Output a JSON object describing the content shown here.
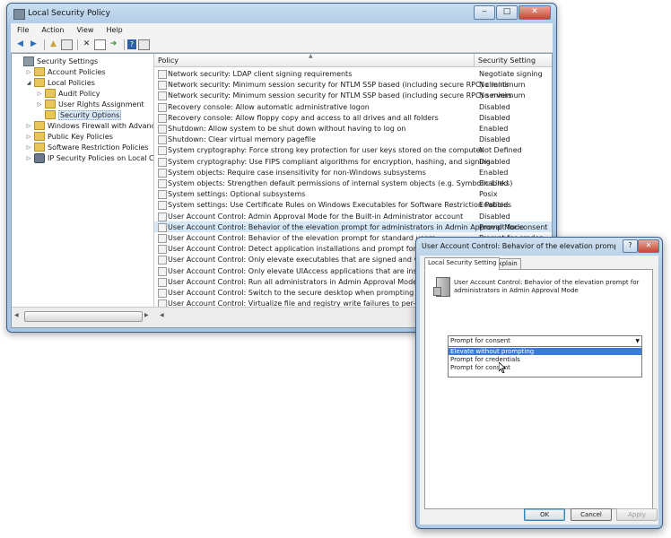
{
  "window": {
    "title": "Local Security Policy",
    "caption_buttons": [
      "‒",
      "□",
      "✕"
    ]
  },
  "menu": [
    "File",
    "Action",
    "View",
    "Help"
  ],
  "tree": [
    {
      "label": "Security Settings",
      "level": 0,
      "toggle": "",
      "icon": "shield"
    },
    {
      "label": "Account Policies",
      "level": 1,
      "toggle": "▷",
      "icon": "folder"
    },
    {
      "label": "Local Policies",
      "level": 1,
      "toggle": "◢",
      "icon": "folder"
    },
    {
      "label": "Audit Policy",
      "level": 2,
      "toggle": "▷",
      "icon": "folder"
    },
    {
      "label": "User Rights Assignment",
      "level": 2,
      "toggle": "▷",
      "icon": "folder"
    },
    {
      "label": "Security Options",
      "level": 2,
      "toggle": "",
      "icon": "folder",
      "selected": true
    },
    {
      "label": "Windows Firewall with Advanced Security",
      "level": 1,
      "toggle": "▷",
      "icon": "folder"
    },
    {
      "label": "Public Key Policies",
      "level": 1,
      "toggle": "▷",
      "icon": "folder"
    },
    {
      "label": "Software Restriction Policies",
      "level": 1,
      "toggle": "▷",
      "icon": "folder"
    },
    {
      "label": "IP Security Policies on Local Computer",
      "level": 1,
      "toggle": "▷",
      "icon": "network"
    }
  ],
  "list": {
    "col_policy": "Policy",
    "col_setting": "Security Setting",
    "rows": [
      {
        "policy": "Network security: LDAP client signing requirements",
        "setting": "Negotiate signing"
      },
      {
        "policy": "Network security: Minimum session security for NTLM SSP based (including secure RPC) clients",
        "setting": "No minimum"
      },
      {
        "policy": "Network security: Minimum session security for NTLM SSP based (including secure RPC) servers",
        "setting": "No minimum"
      },
      {
        "policy": "Recovery console: Allow automatic administrative logon",
        "setting": "Disabled"
      },
      {
        "policy": "Recovery console: Allow floppy copy and access to all drives and all folders",
        "setting": "Disabled"
      },
      {
        "policy": "Shutdown: Allow system to be shut down without having to log on",
        "setting": "Enabled"
      },
      {
        "policy": "Shutdown: Clear virtual memory pagefile",
        "setting": "Disabled"
      },
      {
        "policy": "System cryptography: Force strong key protection for user keys stored on the computer",
        "setting": "Not Defined"
      },
      {
        "policy": "System cryptography: Use FIPS compliant algorithms for encryption, hashing, and signing",
        "setting": "Disabled"
      },
      {
        "policy": "System objects: Require case insensitivity for non-Windows subsystems",
        "setting": "Enabled"
      },
      {
        "policy": "System objects: Strengthen default permissions of internal system objects (e.g. Symbolic Links)",
        "setting": "Enabled"
      },
      {
        "policy": "System settings: Optional subsystems",
        "setting": "Posix"
      },
      {
        "policy": "System settings: Use Certificate Rules on Windows Executables for Software Restriction Policies",
        "setting": "Enabled"
      },
      {
        "policy": "User Account Control: Admin Approval Mode for the Built-in Administrator account",
        "setting": "Disabled"
      },
      {
        "policy": "User Account Control: Behavior of the elevation prompt for administrators in Admin Approval Mode",
        "setting": "Prompt for consent",
        "selected": true
      },
      {
        "policy": "User Account Control: Behavior of the elevation prompt for standard users",
        "setting": "Prompt for creden..."
      },
      {
        "policy": "User Account Control: Detect application installations and prompt for elevation",
        "setting": ""
      },
      {
        "policy": "User Account Control: Only elevate executables that are signed and validated",
        "setting": ""
      },
      {
        "policy": "User Account Control: Only elevate UIAccess applications that are installed in secure locations",
        "setting": ""
      },
      {
        "policy": "User Account Control: Run all administrators in Admin Approval Mode",
        "setting": ""
      },
      {
        "policy": "User Account Control: Switch to the secure desktop when prompting for elevation",
        "setting": ""
      },
      {
        "policy": "User Account Control: Virtualize file and registry write failures to per-user locations",
        "setting": ""
      }
    ]
  },
  "dialog": {
    "title": "User Account Control: Behavior of the elevation prompt for ad...",
    "help": "?",
    "close": "✕",
    "tabs": [
      "Local Security Setting",
      "Explain"
    ],
    "description": "User Account Control: Behavior of the elevation prompt for administrators in Admin Approval Mode",
    "dropdown_value": "Prompt for consent",
    "dropdown_options": [
      "Elevate without prompting",
      "Prompt for credentials",
      "Prompt for consent"
    ],
    "buttons": {
      "ok": "OK",
      "cancel": "Cancel",
      "apply": "Apply"
    }
  }
}
